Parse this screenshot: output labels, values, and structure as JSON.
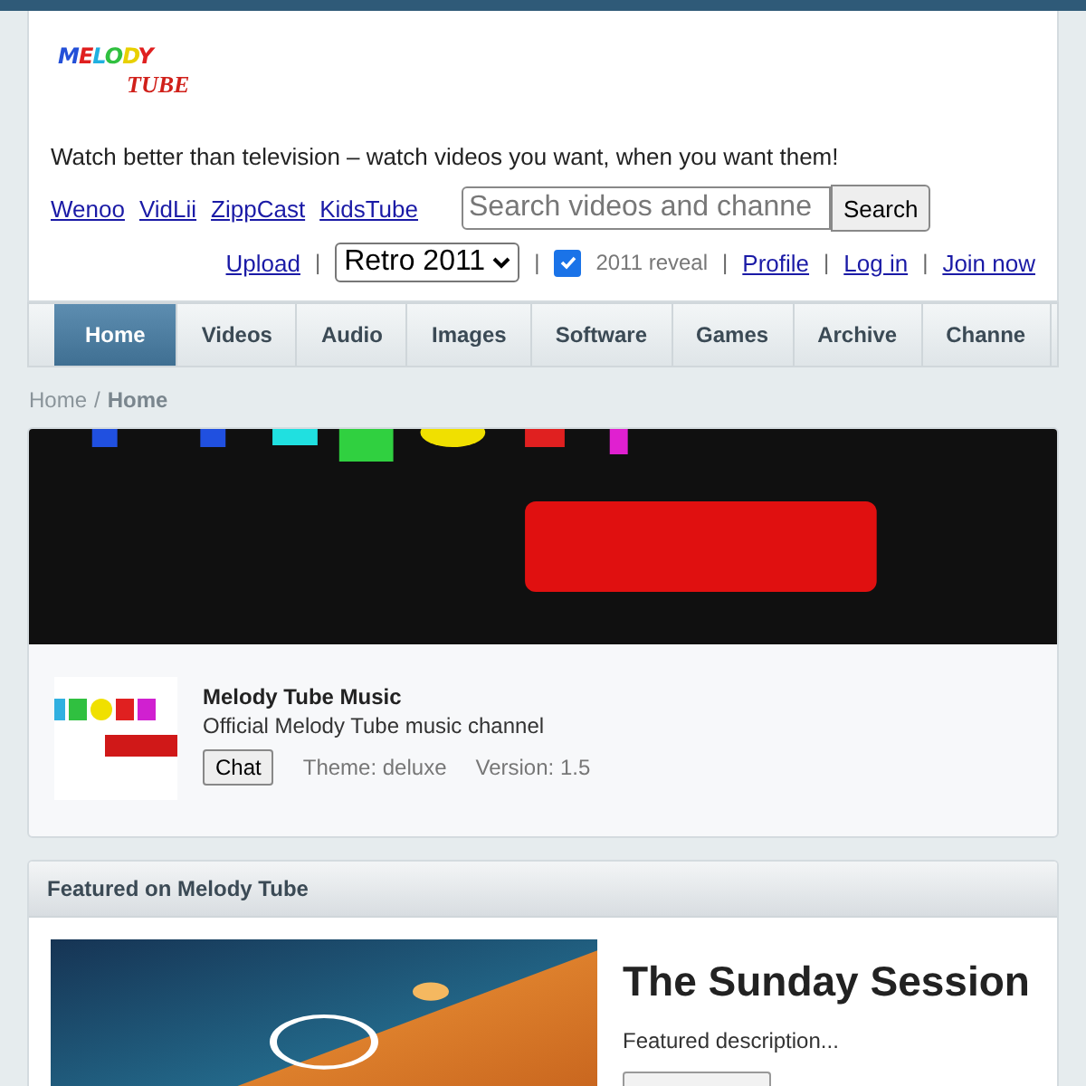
{
  "logo": {
    "top": "MELODY",
    "bottom": "TUBE"
  },
  "tagline": "Watch better than television – watch videos you want, when you want them!",
  "partner_links": [
    "Wenoo",
    "VidLii",
    "ZippCast",
    "KidsTube"
  ],
  "search": {
    "placeholder": "Search videos and channe",
    "button": "Search"
  },
  "user_bar": {
    "separator": "|",
    "upload": "Upload",
    "theme_select": "Retro 2011",
    "reveal": {
      "label": "2011 reveal",
      "checked": true
    },
    "links": [
      "Profile",
      "Log in",
      "Join now"
    ]
  },
  "nav_tabs": [
    {
      "label": "Home",
      "selected": true
    },
    {
      "label": "Videos",
      "selected": false
    },
    {
      "label": "Audio",
      "selected": false
    },
    {
      "label": "Images",
      "selected": false
    },
    {
      "label": "Software",
      "selected": false
    },
    {
      "label": "Games",
      "selected": false
    },
    {
      "label": "Archive",
      "selected": false
    },
    {
      "label": "Channe",
      "selected": false
    }
  ],
  "breadcrumb": {
    "link": "Home",
    "separator": "/",
    "current": "Home"
  },
  "channel": {
    "name": "Melody Tube Music",
    "description": "Official Melody Tube music channel",
    "chat_button": "Chat",
    "theme": "Theme: deluxe",
    "version": "Version: 1.5"
  },
  "featured": {
    "heading": "Featured on Melody Tube",
    "title": "The Sunday Session",
    "description": "Featured description..."
  }
}
